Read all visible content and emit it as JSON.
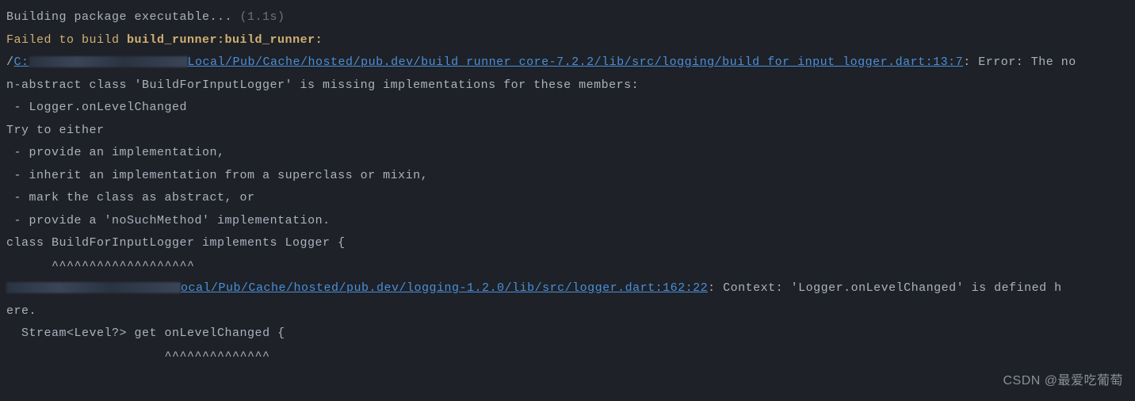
{
  "terminal": {
    "line1_prefix": "Building package executable... ",
    "line1_time": "(1.1s)",
    "line2_prefix": "Failed to build ",
    "line2_package": "build_runner:build_runner:",
    "line3_slash": "/",
    "line3_drive": "C:",
    "line3_path": "Local/Pub/Cache/hosted/pub.dev/build_runner_core-7.2.2/lib/src/logging/build_for_input_logger.dart:13:7",
    "line3_suffix": ": Error: The no",
    "line4": "n-abstract class 'BuildForInputLogger' is missing implementations for these members:",
    "line5": " - Logger.onLevelChanged",
    "line6": "Try to either",
    "line7": " - provide an implementation,",
    "line8": " - inherit an implementation from a superclass or mixin,",
    "line9": " - mark the class as abstract, or",
    "line10": " - provide a 'noSuchMethod' implementation.",
    "line11": "",
    "line12": "class BuildForInputLogger implements Logger {",
    "line13": "      ^^^^^^^^^^^^^^^^^^^",
    "line14_path": "ocal/Pub/Cache/hosted/pub.dev/logging-1.2.0/lib/src/logger.dart:162:22",
    "line14_suffix": ": Context: 'Logger.onLevelChanged' is defined h",
    "line15": "ere.",
    "line16": "  Stream<Level?> get onLevelChanged {",
    "line17": "                     ^^^^^^^^^^^^^^"
  },
  "watermark": "CSDN @最爱吃葡萄"
}
